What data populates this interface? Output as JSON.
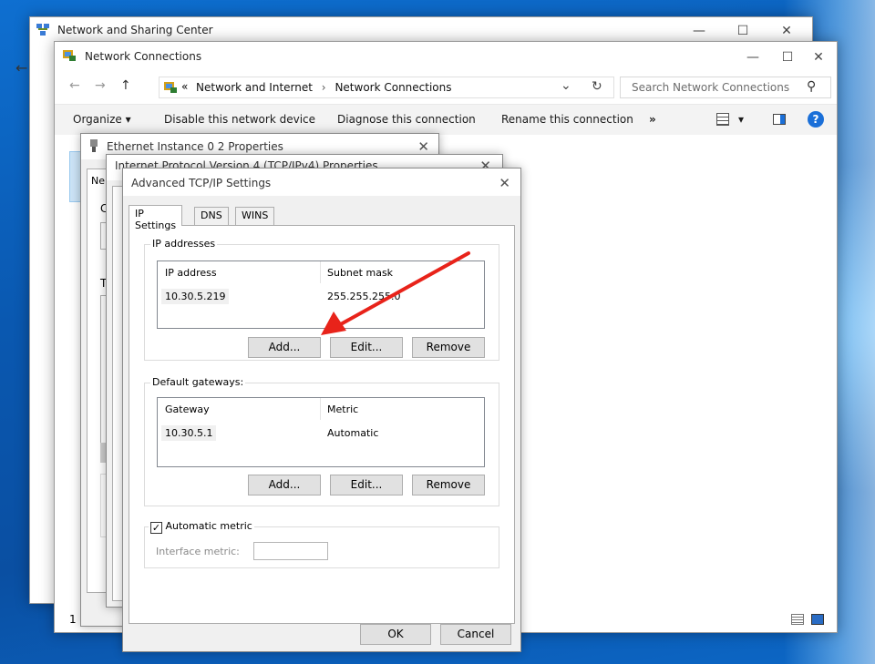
{
  "nsc_window": {
    "title": "Network and Sharing Center",
    "minimize": "—",
    "maximize": "☐",
    "close": "✕"
  },
  "explorer": {
    "title": "Network Connections",
    "minimize": "—",
    "maximize": "☐",
    "close": "✕",
    "nav": {
      "back": "←",
      "forward": "→",
      "up": "↑",
      "address_chevron": "«",
      "dropdown": "⌄",
      "refresh": "↻"
    },
    "breadcrumb": [
      "Network and Internet",
      "Network Connections"
    ],
    "breadcrumb_sep": "›",
    "search": {
      "placeholder": "Search Network Connections",
      "icon": "⚲"
    },
    "ribbon": {
      "organize": "Organize ▾",
      "disable": "Disable this network device",
      "diagnose": "Diagnose this connection",
      "rename": "Rename this connection",
      "more": "»",
      "view_dropdown": "▾"
    },
    "status": "1 item"
  },
  "ethernet_props": {
    "title": "Ethernet Instance 0 2 Properties",
    "close": "✕",
    "tab_label": "Ne",
    "letters": [
      "C",
      "T"
    ]
  },
  "ipv4_props": {
    "title": "Internet Protocol Version 4 (TCP/IPv4) Properties",
    "close": "✕"
  },
  "advanced": {
    "title": "Advanced TCP/IP Settings",
    "close": "✕",
    "tabs": [
      "IP Settings",
      "DNS",
      "WINS"
    ],
    "ip_group": {
      "label": "IP addresses",
      "columns": [
        "IP address",
        "Subnet mask"
      ],
      "rows": [
        [
          "10.30.5.219",
          "255.255.255.0"
        ]
      ],
      "buttons": [
        "Add...",
        "Edit...",
        "Remove"
      ]
    },
    "gw_group": {
      "label": "Default gateways:",
      "columns": [
        "Gateway",
        "Metric"
      ],
      "rows": [
        [
          "10.30.5.1",
          "Automatic"
        ]
      ],
      "buttons": [
        "Add...",
        "Edit...",
        "Remove"
      ]
    },
    "metric": {
      "label": "Automatic metric",
      "checked": "✓",
      "interface_label": "Interface metric:"
    },
    "ok": "OK",
    "cancel": "Cancel"
  },
  "colors": {
    "annotation_arrow": "#e8231a",
    "help": "#1a6fd8",
    "desktop": "#0a5fb8"
  }
}
